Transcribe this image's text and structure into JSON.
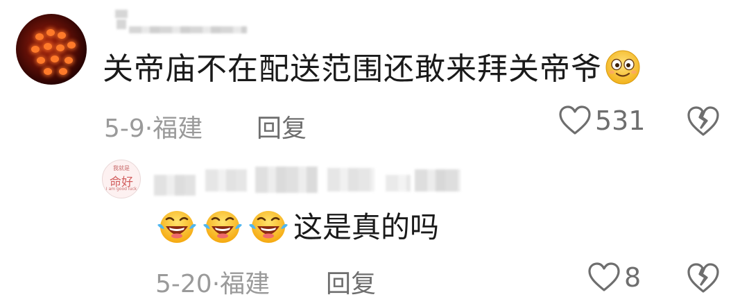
{
  "comments": [
    {
      "text": "关帝庙不在配送范围还敢来拜关帝爷",
      "emoji": "smile-emoji",
      "date": "5-9·",
      "location": "福建",
      "reply_label": "回复",
      "likes": "531"
    },
    {
      "avatar_text_small": "我就是",
      "avatar_text": "命好",
      "avatar_text_tiny": "I am good luck",
      "emoji": "laughing-crying-emoji",
      "emoji_count": 3,
      "text": "这是真的吗",
      "date": "5-20·",
      "location": "福建",
      "reply_label": "回复",
      "likes": "8"
    }
  ],
  "icons": {
    "like": "heart-outline-icon",
    "dislike": "broken-heart-icon"
  },
  "colors": {
    "text": "#1a1a1a",
    "meta": "#9a9a9a",
    "action": "#6e6e6e",
    "icon": "#6e6e6e"
  }
}
